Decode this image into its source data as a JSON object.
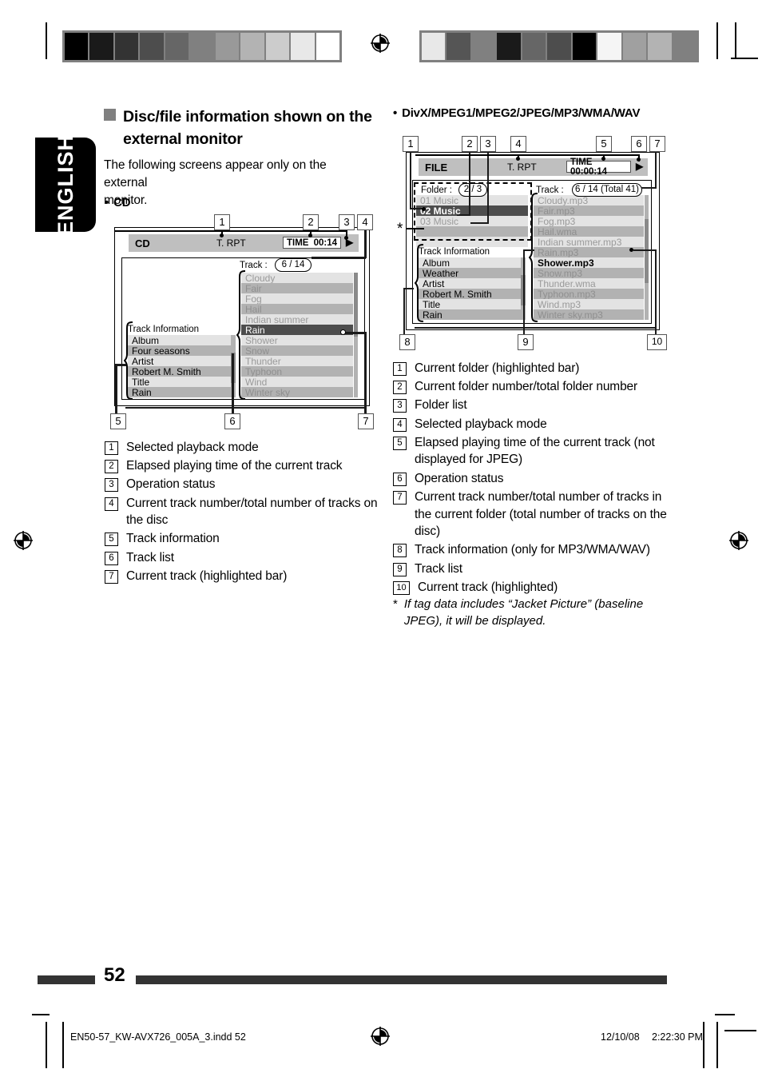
{
  "page": {
    "language_tab": "ENGLISH",
    "number": "52",
    "file_meta": "EN50-57_KW-AVX726_005A_3.indd   52",
    "date_meta": "12/10/08",
    "time_meta": "2:22:30 PM"
  },
  "section": {
    "heading_line1": "Disc/file information shown on the",
    "heading_line2": "external monitor",
    "intro_line1": "The following screens appear only on the external",
    "intro_line2": "monitor.",
    "cd_bullet": "CD",
    "divx_bullet": "DivX/MPEG1/MPEG2/JPEG/MP3/WMA/WAV"
  },
  "cd_screen": {
    "source_label": "CD",
    "repeat_mode": "T. RPT",
    "time_label": "TIME",
    "time_value": "00:14",
    "play_icon": "play-icon",
    "track_label": "Track :",
    "track_counter": "6 / 14",
    "info_title": "Track Information",
    "info_rows": [
      "Album",
      "Four seasons",
      "Artist",
      "Robert M. Smith",
      "Title",
      "Rain"
    ],
    "track_rows": [
      "Cloudy",
      "Fair",
      "Fog",
      "Hail",
      "Indian summer",
      "Rain",
      "Shower",
      "Snow",
      "Thunder",
      "Typhoon",
      "Wind",
      "Winter sky"
    ],
    "selected_track": "Rain",
    "selected_index": 5,
    "callouts": [
      "1",
      "2",
      "3",
      "4",
      "5",
      "6",
      "7"
    ]
  },
  "file_screen": {
    "source_label": "FILE",
    "repeat_mode": "T. RPT",
    "time_text": "TIME 00:00:14",
    "play_icon": "play-icon",
    "folder_label": "Folder :",
    "folder_counter": "2 / 3",
    "folder_rows": [
      "01 Music",
      "02 Music",
      "03 Music",
      "",
      ""
    ],
    "selected_folder": "02 Music",
    "selected_folder_index": 1,
    "track_label": "Track :",
    "track_counter": "6 / 14 (Total 41)",
    "info_title": "Track Information",
    "info_rows": [
      "Album",
      "Weather",
      "Artist",
      "Robert M. Smith",
      "Title",
      "Rain"
    ],
    "track_rows": [
      "Cloudy.mp3",
      "Fair.mp3",
      "Fog.mp3",
      "Hail.wma",
      "Indian summer.mp3",
      "Rain.mp3",
      "Shower.mp3",
      "Snow.mp3",
      "Thunder.wma",
      "Typhoon.mp3",
      "Wind.mp3",
      "Winter sky.mp3"
    ],
    "selected_track": "Shower.mp3",
    "selected_index": 6,
    "jacket_marker": "*",
    "callouts": [
      "1",
      "2",
      "3",
      "4",
      "5",
      "6",
      "7",
      "8",
      "9",
      "10"
    ]
  },
  "cd_legend": [
    {
      "n": "1",
      "text": "Selected playback mode"
    },
    {
      "n": "2",
      "text": "Elapsed playing time of the current track"
    },
    {
      "n": "3",
      "text": "Operation status"
    },
    {
      "n": "4",
      "text": "Current track number/total number of tracks on the disc"
    },
    {
      "n": "5",
      "text": "Track information"
    },
    {
      "n": "6",
      "text": "Track list"
    },
    {
      "n": "7",
      "text": "Current track (highlighted bar)"
    }
  ],
  "file_legend": [
    {
      "n": "1",
      "text": "Current folder (highlighted bar)"
    },
    {
      "n": "2",
      "text": "Current folder number/total folder number"
    },
    {
      "n": "3",
      "text": "Folder list"
    },
    {
      "n": "4",
      "text": "Selected playback mode"
    },
    {
      "n": "5",
      "text": "Elapsed playing time of the current track (not displayed for JPEG)"
    },
    {
      "n": "6",
      "text": "Operation status"
    },
    {
      "n": "7",
      "text": "Current track number/total number of tracks in the current folder (total number of tracks on the disc)"
    },
    {
      "n": "8",
      "text": "Track information (only for MP3/WMA/WAV)"
    },
    {
      "n": "9",
      "text": "Track list"
    },
    {
      "n": "10",
      "text": "Current track (highlighted)"
    }
  ],
  "footnote": {
    "marker": "*",
    "text": "If tag data includes “Jacket Picture” (baseline JPEG), it will be displayed."
  },
  "calibration": {
    "left_strip": [
      "#000000",
      "#1a1a1a",
      "#333333",
      "#4d4d4d",
      "#666666",
      "#808080",
      "#999999",
      "#b3b3b3",
      "#cccccc",
      "#e8e8e8",
      "#ffffff"
    ],
    "right_strip": [
      "#e8e8e8",
      "#555555",
      "#808080",
      "#1a1a1a",
      "#666666",
      "#4d4d4d",
      "#000000",
      "#f5f5f5",
      "#a0a0a0",
      "#b3b3b3",
      "#808080"
    ]
  }
}
